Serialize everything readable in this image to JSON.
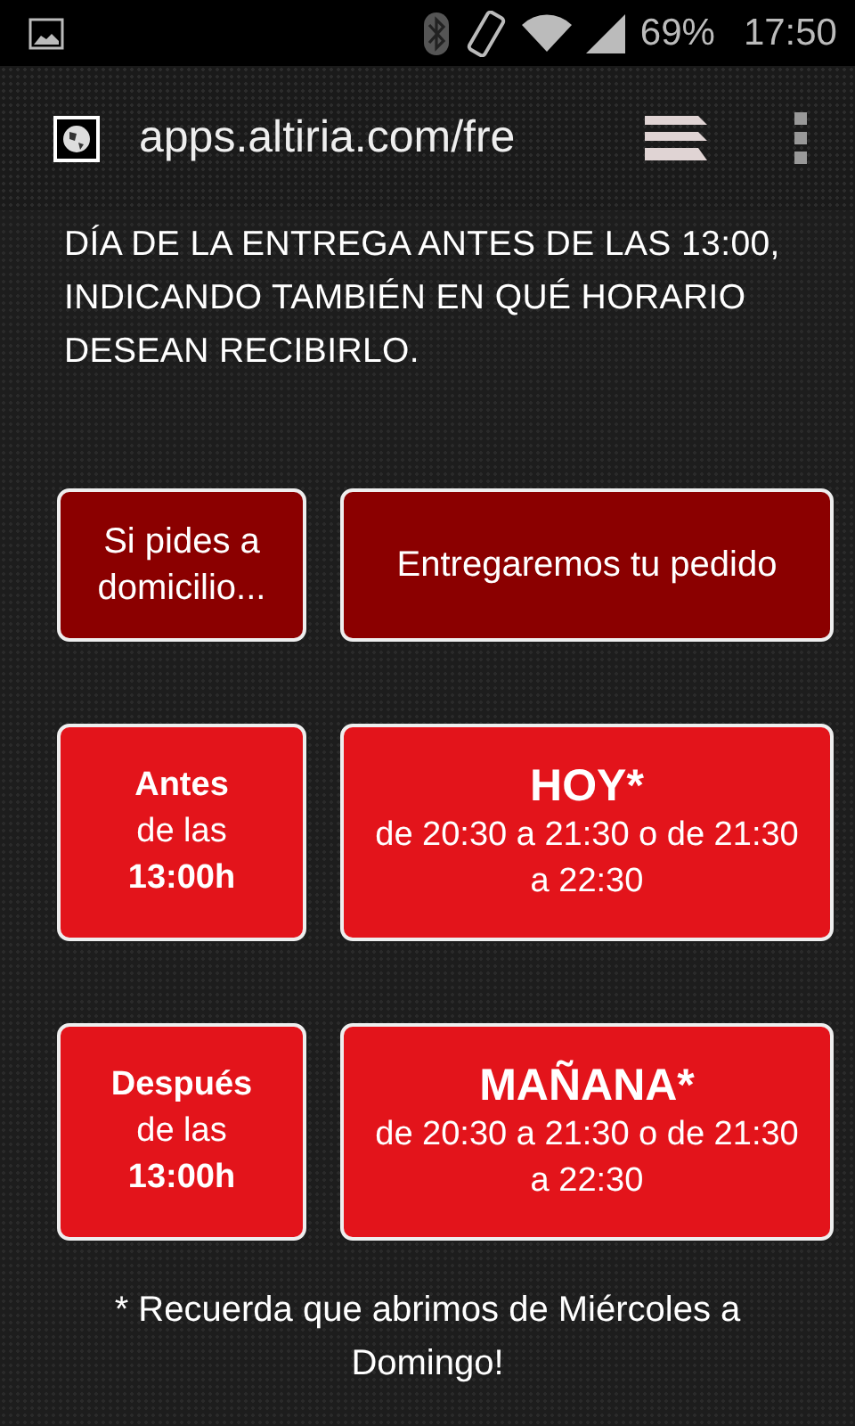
{
  "status_bar": {
    "battery": "69%",
    "time": "17:50"
  },
  "browser": {
    "url": "apps.altiria.com/fre"
  },
  "intro": "DÍA DE LA ENTREGA ANTES DE LAS 13:00, INDICANDO TAMBIÉN EN QUÉ HORARIO DESEAN RECIBIRLO.",
  "rows": [
    {
      "kind": "header",
      "left": "Si pides a domicilio...",
      "right": "Entregaremos tu pedido"
    },
    {
      "kind": "option",
      "left": "**Antes** de las **13:00h**",
      "title": "HOY*",
      "detail": "de 20:30 a 21:30 o de 21:30 a 22:30"
    },
    {
      "kind": "option",
      "left": "**Después** de las **13:00h**",
      "title": "MAÑANA*",
      "detail": "de 20:30 a 21:30 o de 21:30 a 22:30"
    }
  ],
  "note": "* Recuerda que abrimos de Miércoles a Domingo!"
}
